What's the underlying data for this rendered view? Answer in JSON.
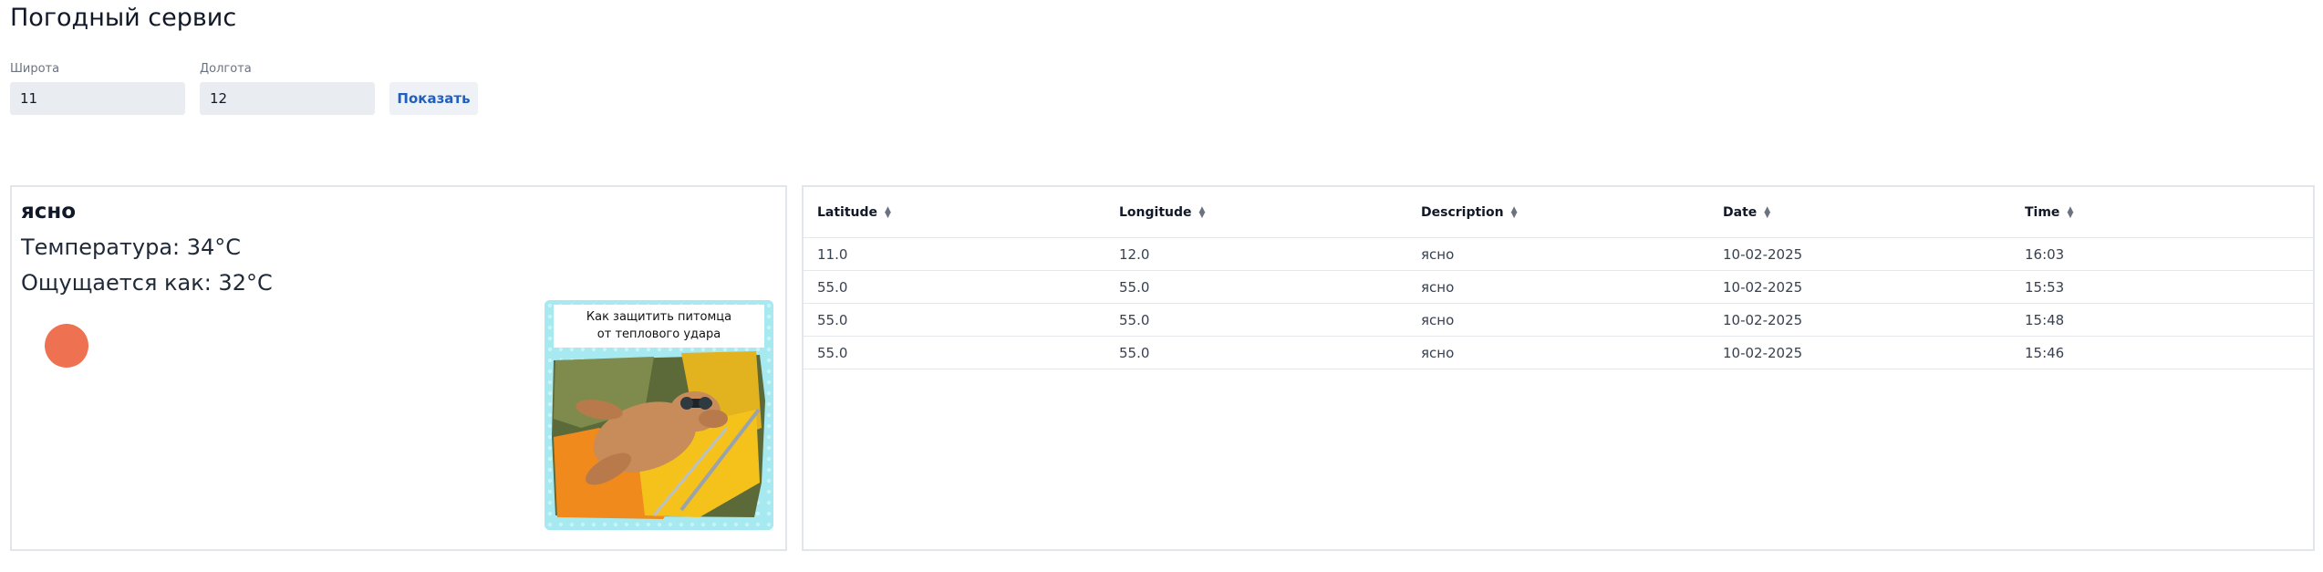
{
  "app": {
    "title": "Погодный сервис"
  },
  "form": {
    "latitude_label": "Широта",
    "latitude_value": "11",
    "longitude_label": "Долгота",
    "longitude_value": "12",
    "submit_label": "Показать"
  },
  "weather": {
    "description": "ясно",
    "temperature": "Температура: 34°C",
    "feels_like": "Ощущается как: 32°C",
    "icon": "sun-icon",
    "icon_color": "#ee7151",
    "promo": {
      "line1": "Как защитить питомца",
      "line2": "от теплового удара"
    }
  },
  "history": {
    "columns": [
      "Latitude",
      "Longitude",
      "Description",
      "Date",
      "Time"
    ],
    "rows": [
      [
        "11.0",
        "12.0",
        "ясно",
        "10-02-2025",
        "16:03"
      ],
      [
        "55.0",
        "55.0",
        "ясно",
        "10-02-2025",
        "15:53"
      ],
      [
        "55.0",
        "55.0",
        "ясно",
        "10-02-2025",
        "15:48"
      ],
      [
        "55.0",
        "55.0",
        "ясно",
        "10-02-2025",
        "15:46"
      ]
    ]
  },
  "colors": {
    "accent": "#1f5fbf",
    "input_bg": "#e9ecf0",
    "border": "#e2e5e9"
  }
}
